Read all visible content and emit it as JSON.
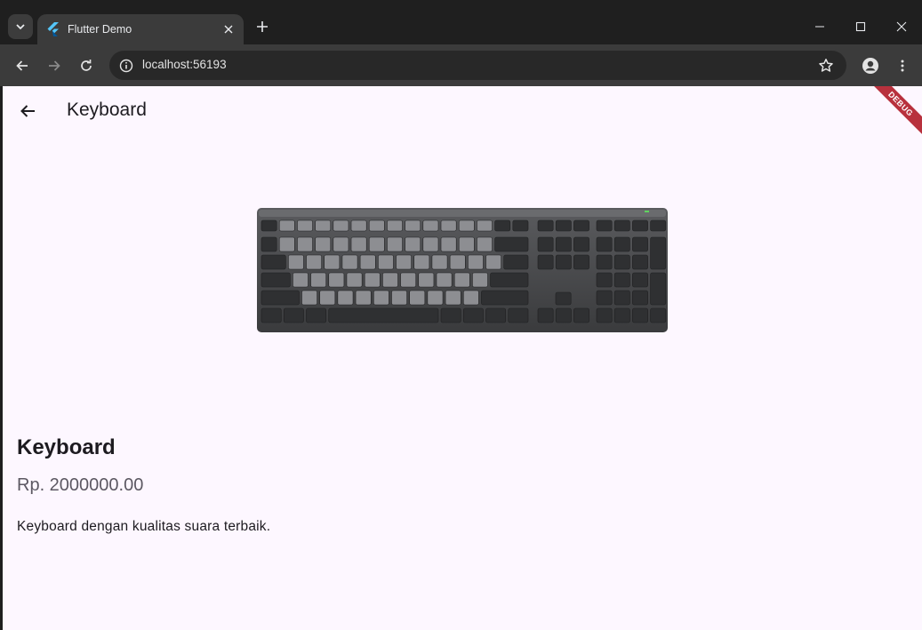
{
  "browser": {
    "tab_title": "Flutter Demo",
    "url": "localhost:56193"
  },
  "app": {
    "appbar_title": "Keyboard",
    "debug_banner": "DEBUG"
  },
  "product": {
    "name": "Keyboard",
    "price": "Rp. 2000000.00",
    "description": "Keyboard dengan kualitas suara terbaik."
  },
  "colors": {
    "page_background": "#fdf7ff",
    "debug_banner": "#b8313d"
  }
}
